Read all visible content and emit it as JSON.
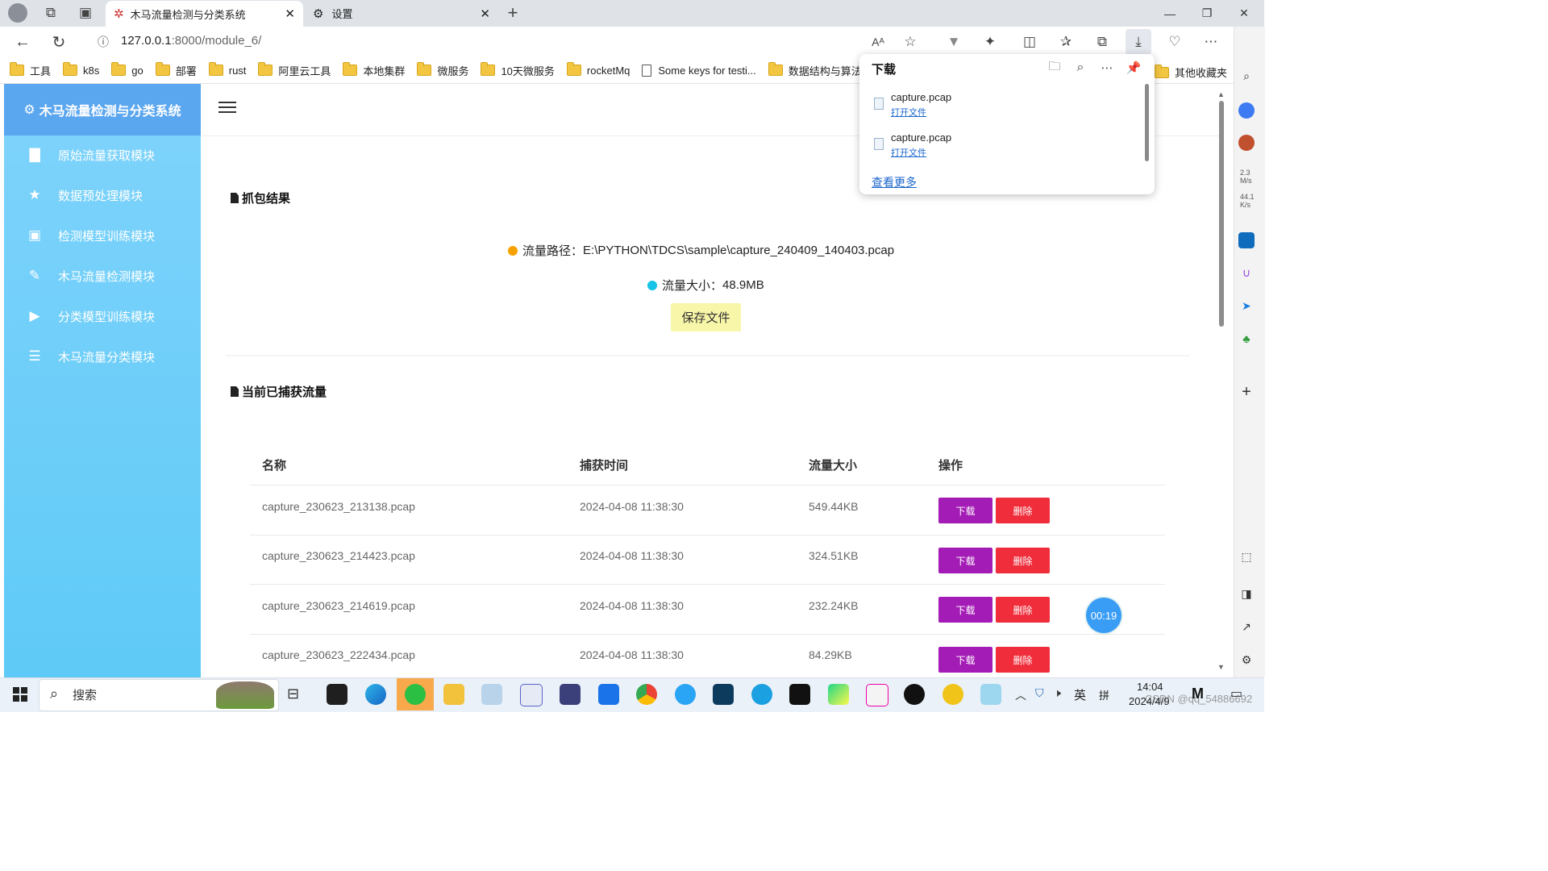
{
  "browser": {
    "tabs": [
      {
        "title": "木马流量检测与分类系统",
        "active": true
      },
      {
        "title": "设置",
        "active": false
      }
    ],
    "url_host": "127.0.0.1",
    "url_rest": ":8000/module_6/",
    "bookmarks": [
      "工具",
      "k8s",
      "go",
      "部署",
      "rust",
      "阿里云工具",
      "本地集群",
      "微服务",
      "10天微服务",
      "rocketMq",
      "Some keys for testi...",
      "数据结构与算法",
      "其他收藏夹"
    ],
    "edge_stats": [
      "2.3",
      "M/s",
      "44.1",
      "K/s"
    ]
  },
  "downloads": {
    "title": "下载",
    "items": [
      {
        "name": "capture.pcap",
        "action": "打开文件"
      },
      {
        "name": "capture.pcap",
        "action": "打开文件"
      }
    ],
    "more": "查看更多"
  },
  "app": {
    "brand": "木马流量检测与分类系统",
    "menu": [
      {
        "label": "原始流量获取模块",
        "icon": "file-icon"
      },
      {
        "label": "数据预处理模块",
        "icon": "star-icon"
      },
      {
        "label": "检测模型训练模块",
        "icon": "play-square-icon"
      },
      {
        "label": "木马流量检测模块",
        "icon": "edit-icon"
      },
      {
        "label": "分类模型训练模块",
        "icon": "play-icon"
      },
      {
        "label": "木马流量分类模块",
        "icon": "tree-list-icon"
      }
    ],
    "capture": {
      "title": "抓包结果",
      "path_label": "流量路径：",
      "path_value": "E:\\PYTHON\\TDCS\\sample\\capture_240409_140403.pcap",
      "size_label": "流量大小：",
      "size_value": "48.9MB",
      "save_label": "保存文件"
    },
    "table": {
      "title": "当前已捕获流量",
      "headers": [
        "名称",
        "捕获时间",
        "流量大小",
        "操作"
      ],
      "rows": [
        {
          "name": "capture_230623_213138.pcap",
          "time": "2024-04-08 11:38:30",
          "size": "549.44KB"
        },
        {
          "name": "capture_230623_214423.pcap",
          "time": "2024-04-08 11:38:30",
          "size": "324.51KB"
        },
        {
          "name": "capture_230623_214619.pcap",
          "time": "2024-04-08 11:38:30",
          "size": "232.24KB"
        },
        {
          "name": "capture_230623_222434.pcap",
          "time": "2024-04-08 11:38:30",
          "size": "84.29KB"
        }
      ],
      "download_label": "下载",
      "delete_label": "删除"
    },
    "timer": "00:19"
  },
  "taskbar": {
    "search": "搜索",
    "tray_lang": "英",
    "tray_input": "拼",
    "time": "14:04",
    "date": "2024/4/9",
    "watermark": "CSDN @qq_54886692"
  },
  "colors": {
    "sidebar": "#6ecff9",
    "brand": "#5aa6ef",
    "download_btn": "#a31cb5",
    "delete_btn": "#ef2d3b",
    "save_btn": "#f8f6a8",
    "path_dot": "#f7a100",
    "size_dot": "#17c3e6"
  }
}
